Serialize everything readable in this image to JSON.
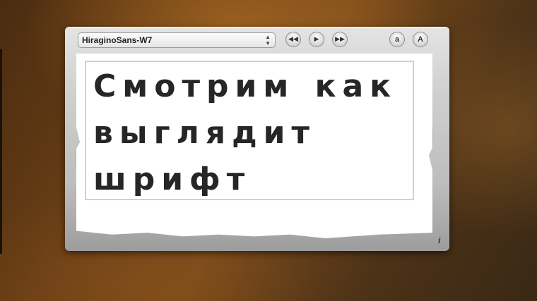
{
  "font_selector": {
    "value": "HiraginoSans-W7",
    "arrows_icon": "updown-arrows-icon"
  },
  "controls": {
    "rewind_icon": "rewind-icon",
    "play_icon": "play-icon",
    "fast_forward_icon": "fast-forward-icon",
    "smaller_label": "a",
    "larger_label": "A"
  },
  "preview": {
    "text": "Смотрим как выглядит шрифт"
  },
  "info": {
    "label": "i"
  }
}
